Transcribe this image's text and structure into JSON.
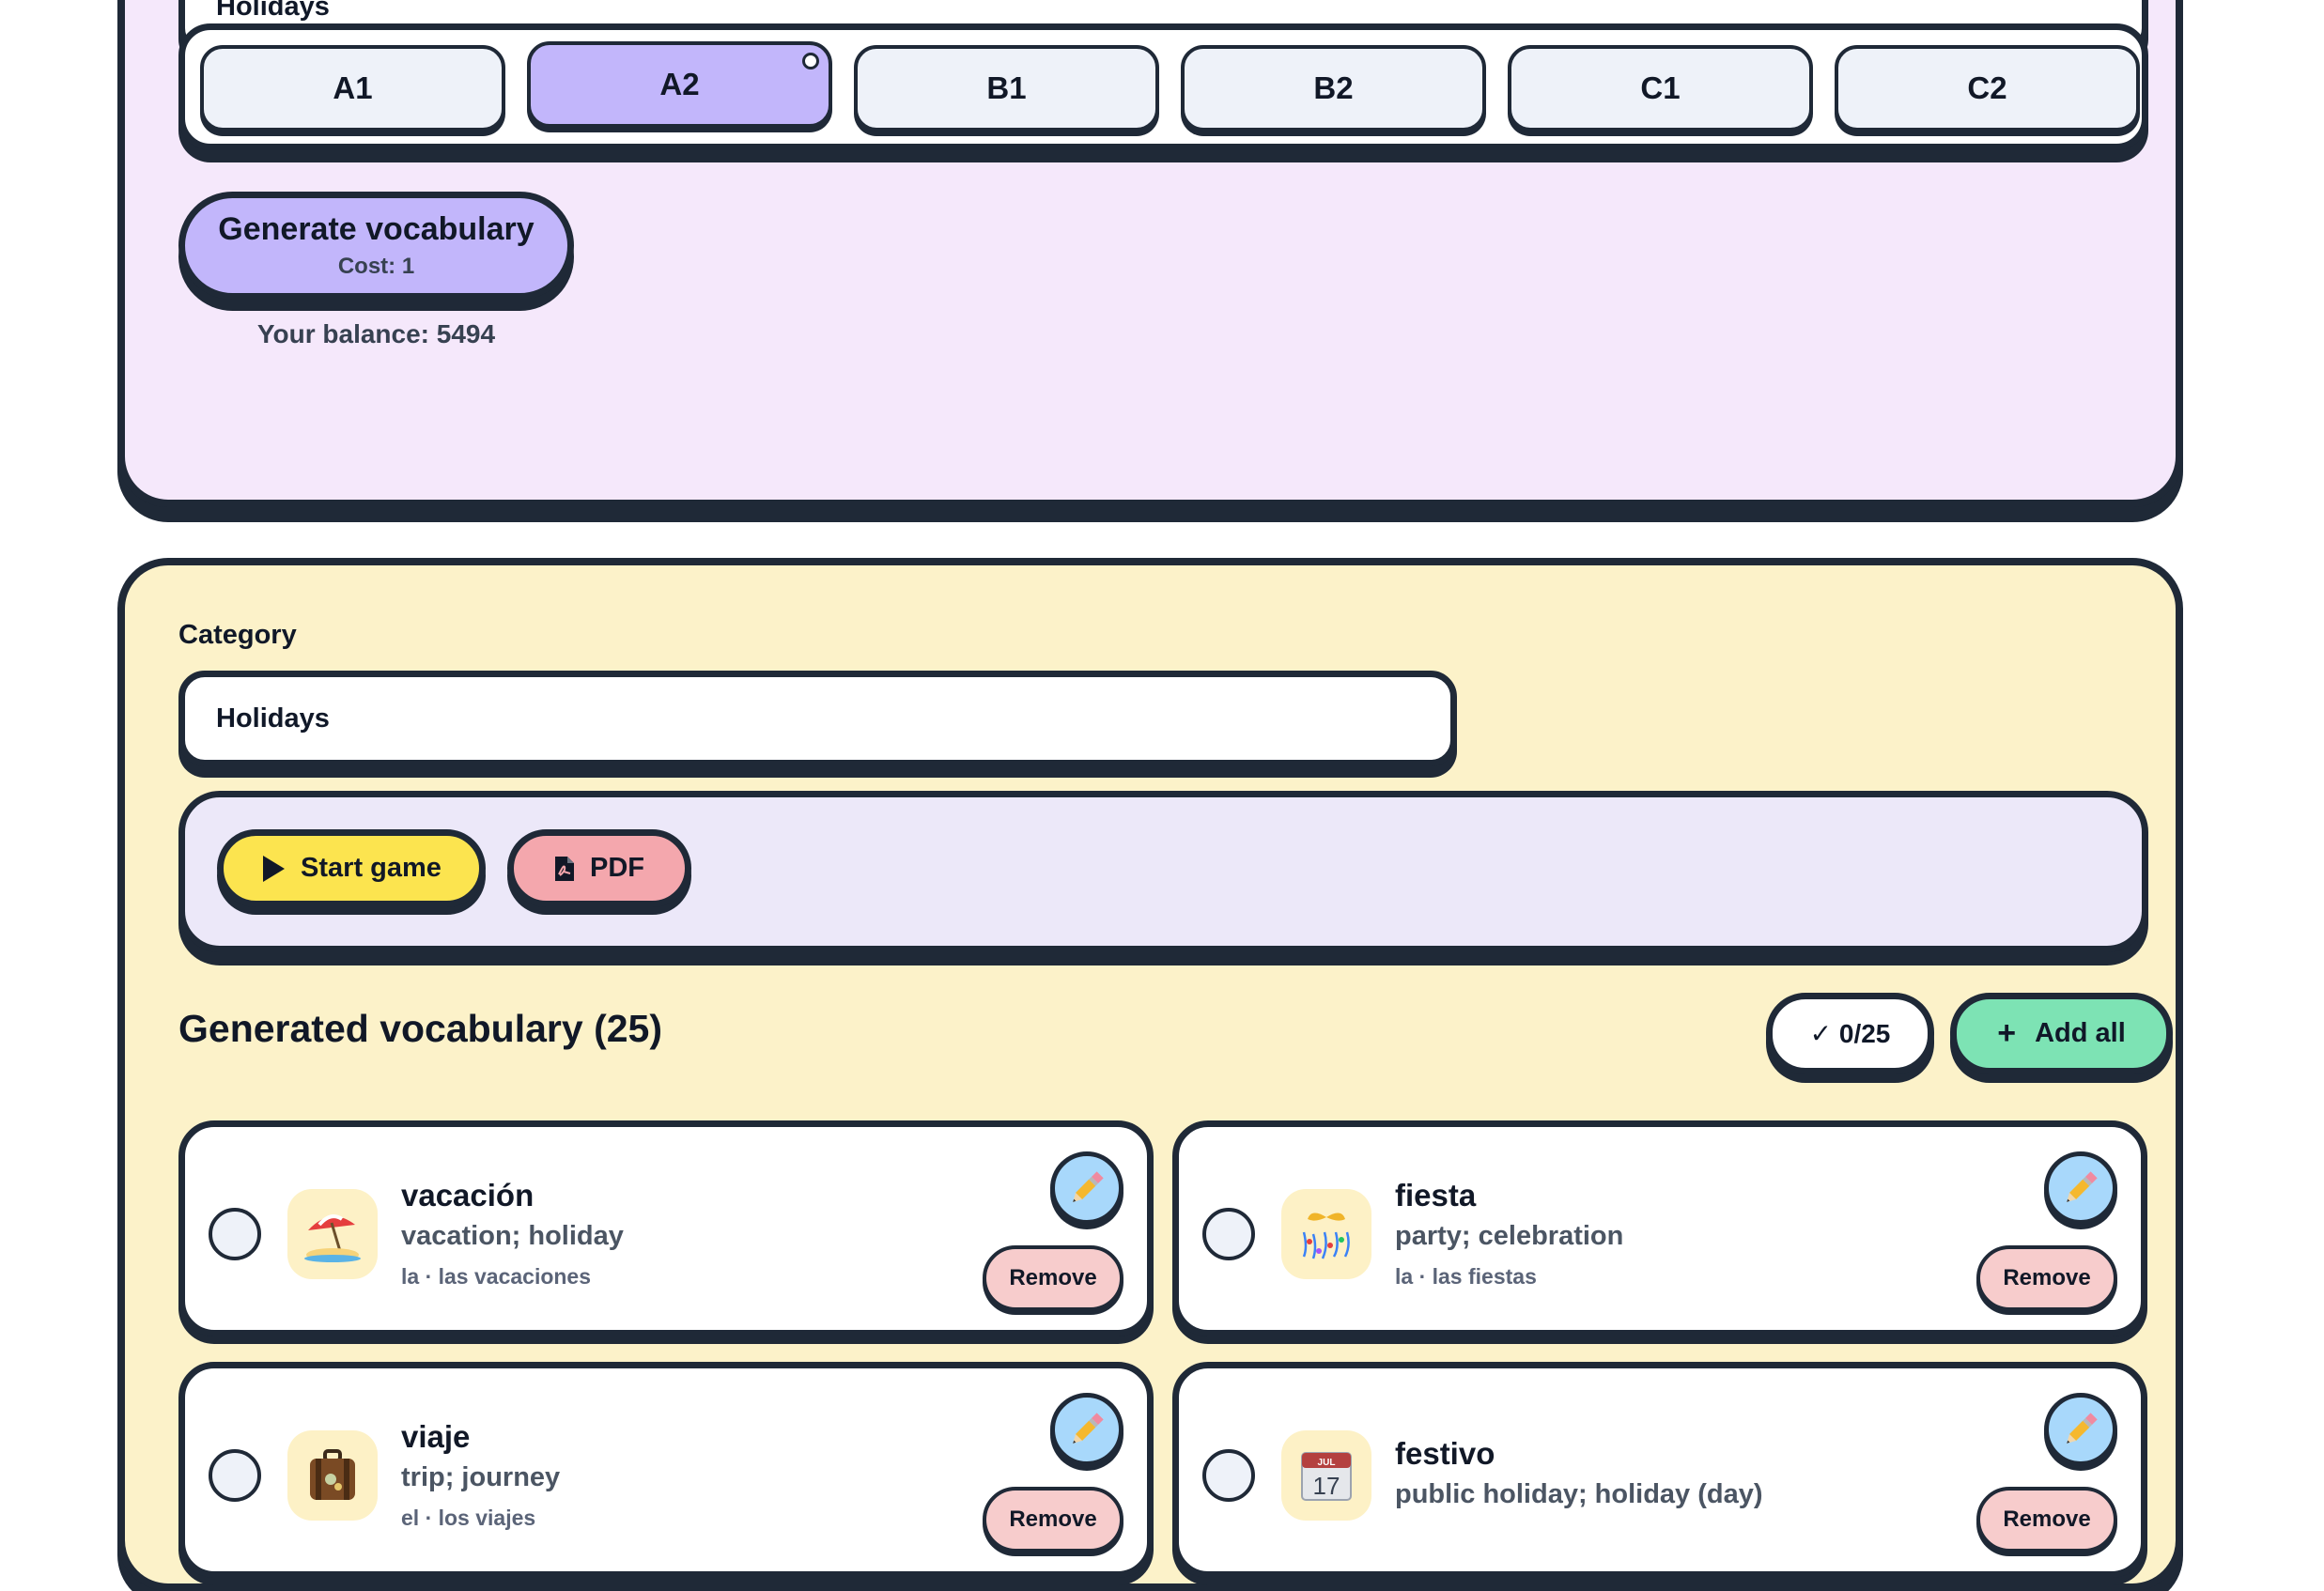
{
  "generator": {
    "topic_value": "Holidays",
    "levels": [
      "A1",
      "A2",
      "B1",
      "B2",
      "C1",
      "C2"
    ],
    "selected_level": "A2",
    "generate_label": "Generate vocabulary",
    "cost_label": "Cost: 1",
    "balance_label": "Your balance: 5494"
  },
  "results": {
    "category_label": "Category",
    "category_value": "Holidays",
    "start_game_label": "Start game",
    "pdf_label": "PDF",
    "title": "Generated vocabulary (25)",
    "selected_count": "✓ 0/25",
    "add_all_label": "Add all",
    "remove_label": "Remove",
    "cards": [
      {
        "icon": "beach-umbrella-icon",
        "word": "vacación",
        "meaning": "vacation; holiday",
        "forms": "la · las vacaciones"
      },
      {
        "icon": "party-popper-icon",
        "word": "fiesta",
        "meaning": "party; celebration",
        "forms": "la · las fiestas"
      },
      {
        "icon": "suitcase-icon",
        "word": "viaje",
        "meaning": "trip; journey",
        "forms": "el · los viajes"
      },
      {
        "icon": "calendar-icon",
        "word": "festivo",
        "meaning": "public holiday; holiday (day)",
        "forms": ""
      }
    ]
  },
  "colors": {
    "top_panel": "#f5e8fb",
    "bottom_panel": "#fcf2c9",
    "accent_purple": "#c2b6fb",
    "start_yellow": "#fce44f",
    "pdf_pink": "#f4a7ad",
    "add_green": "#7de3b4",
    "border": "#1f2937"
  }
}
